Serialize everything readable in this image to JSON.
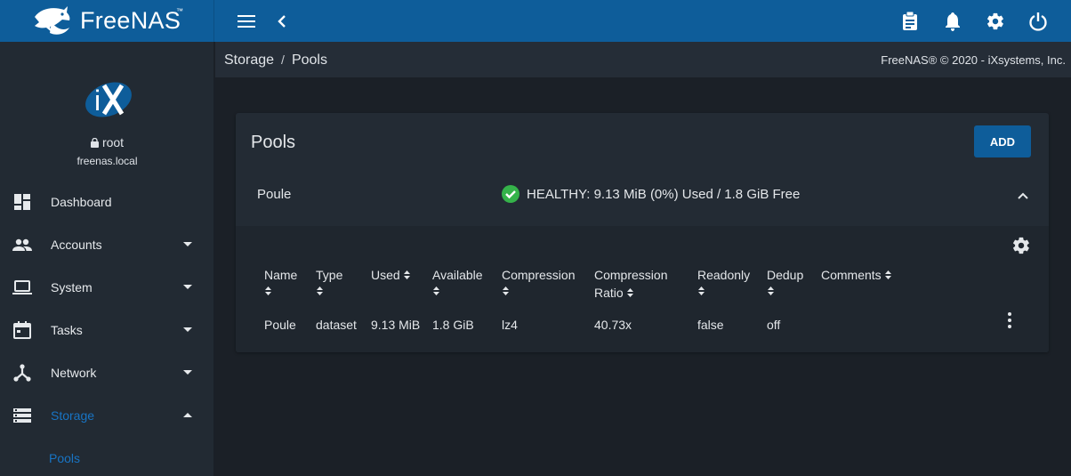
{
  "brand": {
    "name": "FreeNAS",
    "tm": "™"
  },
  "topbar": {
    "menu_icon": "hamburger-icon",
    "back_icon": "chevron-left-icon",
    "right_icons": [
      "clipboard-icon",
      "bell-icon",
      "gear-icon",
      "power-icon"
    ]
  },
  "sidebar": {
    "user": "root",
    "host": "freenas.local",
    "items": [
      {
        "label": "Dashboard",
        "icon": "dashboard-icon",
        "expandable": false
      },
      {
        "label": "Accounts",
        "icon": "people-icon",
        "expandable": true
      },
      {
        "label": "System",
        "icon": "laptop-icon",
        "expandable": true
      },
      {
        "label": "Tasks",
        "icon": "calendar-icon",
        "expandable": true
      },
      {
        "label": "Network",
        "icon": "network-icon",
        "expandable": true
      },
      {
        "label": "Storage",
        "icon": "storage-icon",
        "expandable": true,
        "active": true
      }
    ],
    "sub_item": "Pools"
  },
  "breadcrumb": {
    "parent": "Storage",
    "sep": "/",
    "current": "Pools"
  },
  "copyright": "FreeNAS® © 2020 - iXsystems, Inc.",
  "card": {
    "title": "Pools",
    "add_label": "ADD",
    "pool": {
      "name": "Poule",
      "status": "HEALTHY: 9.13 MiB (0%) Used / 1.8 GiB Free"
    },
    "columns": [
      "Name",
      "Type",
      "Used",
      "Available",
      "Compression",
      "Compression",
      "Ratio",
      "Readonly",
      "Dedup",
      "Comments"
    ],
    "row": [
      "Poule",
      "dataset",
      "9.13 MiB",
      "1.8 GiB",
      "lz4",
      "40.73x",
      "false",
      "off"
    ]
  },
  "colors": {
    "topbar": "#0e5d9a",
    "accent": "#1874c4",
    "healthy": "#35b34a",
    "sidebar": "#222a33",
    "background": "#1b2027"
  }
}
